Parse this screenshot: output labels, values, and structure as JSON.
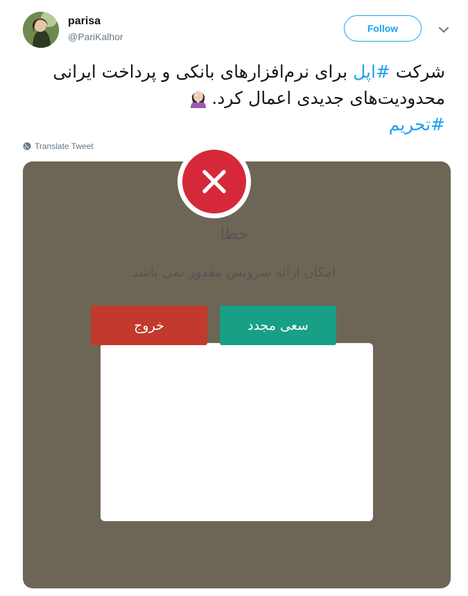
{
  "user": {
    "name": "parisa",
    "handle": "@PariKalhor",
    "avatar_icon": "profile-photo"
  },
  "follow_label": "Follow",
  "tweet": {
    "line1_before": "شرکت ",
    "line1_hashtag": "#اپل",
    "line1_after": " برای نرم‌افزارهای بانکی و پرداخت ایرانی",
    "line2": "محدودیت‌های جدیدی اعمال کرد.",
    "line2_emoji": "woman-facepalming-emoji",
    "line3_hashtag": "#تحریم"
  },
  "translate_label": "Translate Tweet",
  "colors": {
    "link": "#1da1f2",
    "media_background": "#6d6656",
    "error_red": "#d5293a",
    "exit_button": "#c23a2b",
    "retry_button": "#17a086"
  },
  "dialog": {
    "icon": "close-x-icon",
    "title": "خطا",
    "message": "امکان ارائه سرویس مقدور نمی باشد",
    "exit_label": "خروج",
    "retry_label": "سعی مجدد"
  }
}
